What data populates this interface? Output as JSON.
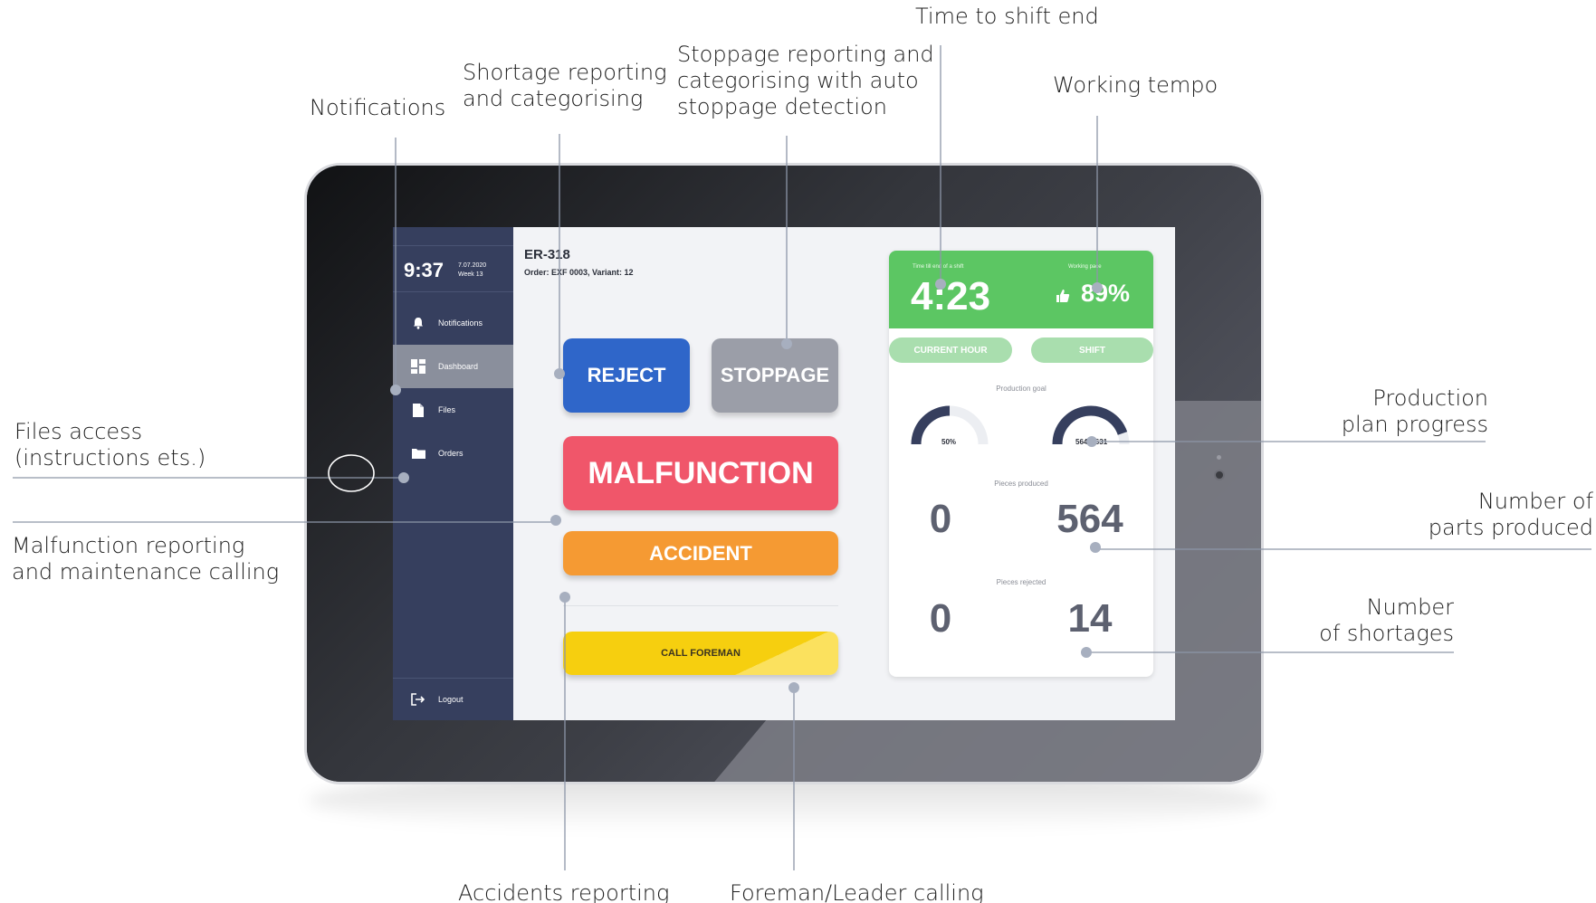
{
  "callouts": {
    "time_to_shift_end": "Time to shift end",
    "working_tempo": "Working tempo",
    "stoppage": "Stoppage reporting and\ncategorising with auto\nstoppage detection",
    "shortage": "Shortage reporting\nand categorising",
    "notifications": "Notifications",
    "files_access": "Files access\n(instructions ets.)",
    "malfunction": "Malfunction reporting\nand maintenance calling",
    "production_plan": "Production\nplan progress",
    "parts_produced": "Number of\nparts produced",
    "shortages": "Number\nof shortages",
    "accidents": "Accidents reporting",
    "foreman": "Foreman/Leader calling"
  },
  "sidebar": {
    "time": "9:37",
    "date": "7.07.2020",
    "week": "Week 13",
    "items": [
      {
        "label": "Notifications",
        "icon": "bell-icon"
      },
      {
        "label": "Dashboard",
        "icon": "dashboard-icon",
        "active": true
      },
      {
        "label": "Files",
        "icon": "file-icon"
      },
      {
        "label": "Orders",
        "icon": "folder-icon"
      }
    ],
    "logout": "Logout"
  },
  "main": {
    "title": "ER-318",
    "subtitle": "Order: EXF 0003, Variant: 12",
    "buttons": {
      "reject": "REJECT",
      "stoppage": "STOPPAGE",
      "malfunction": "MALFUNCTION",
      "accident": "ACCIDENT",
      "call_foreman": "CALL FOREMAN"
    }
  },
  "panel": {
    "time_label": "Time till end of a shift",
    "time_value": "4:23",
    "pace_label": "Working pace",
    "pace_value": "89%",
    "tabs": {
      "current_hour": "CURRENT HOUR",
      "shift": "SHIFT"
    },
    "production_goal_label": "Production goal",
    "goal_current": {
      "text": "50%",
      "fraction": 0.5
    },
    "goal_shift": {
      "text": "564 z 631",
      "fraction": 0.894
    },
    "pieces_produced_label": "Pieces produced",
    "produced_current": "0",
    "produced_shift": "564",
    "pieces_rejected_label": "Pieces rejected",
    "rejected_current": "0",
    "rejected_shift": "14"
  },
  "colors": {
    "sidebar": "#363f5e",
    "reject": "#2f66c9",
    "stoppage": "#9b9ea8",
    "malfunction": "#f0566a",
    "accident": "#f59a33",
    "foreman": "#f6cf0f",
    "panel_header": "#5cc663",
    "gauge": "#363f5e"
  }
}
